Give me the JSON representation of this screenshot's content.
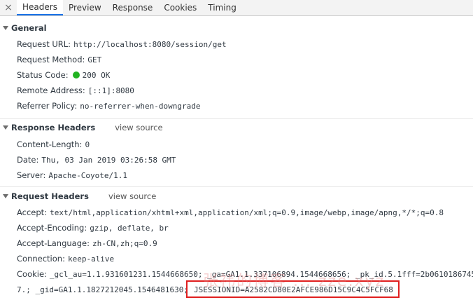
{
  "tabs": {
    "close": "×",
    "items": [
      "Headers",
      "Preview",
      "Response",
      "Cookies",
      "Timing"
    ],
    "active": "Headers"
  },
  "general": {
    "title": "General",
    "rows": [
      {
        "key": "Request URL:",
        "value": "http://localhost:8080/session/get"
      },
      {
        "key": "Request Method:",
        "value": "GET"
      },
      {
        "key": "Status Code:",
        "value": "200 OK"
      },
      {
        "key": "Remote Address:",
        "value": "[::1]:8080"
      },
      {
        "key": "Referrer Policy:",
        "value": "no-referrer-when-downgrade"
      }
    ]
  },
  "response_headers": {
    "title": "Response Headers",
    "view_source": "view source",
    "rows": [
      {
        "key": "Content-Length:",
        "value": "0"
      },
      {
        "key": "Date:",
        "value": "Thu, 03 Jan 2019 03:26:58 GMT"
      },
      {
        "key": "Server:",
        "value": "Apache-Coyote/1.1"
      }
    ]
  },
  "request_headers": {
    "title": "Request Headers",
    "view_source": "view source",
    "rows": [
      {
        "key": "Accept:",
        "value": "text/html,application/xhtml+xml,application/xml;q=0.9,image/webp,image/apng,*/*;q=0.8"
      },
      {
        "key": "Accept-Encoding:",
        "value": "gzip, deflate, br"
      },
      {
        "key": "Accept-Language:",
        "value": "zh-CN,zh;q=0.9"
      },
      {
        "key": "Connection:",
        "value": "keep-alive"
      }
    ],
    "cookie_key": "Cookie:",
    "cookie_line1": "_gcl_au=1.1.931601231.1544668650; _ga=GA1.1.337106894.1544668656; _pk_id.5.1fff=2b0610186745",
    "cookie_line2": "7.; _gid=GA1.1.1827212045.1546481630;",
    "cookie_session": "JSESSIONID=A2582CD80E2AFCE986D15C9C4C5FCF68"
  },
  "watermark": "张祎的博客 ... zze.xyz",
  "colors": {
    "status_ok": "#21b321",
    "highlight": "#e01f1f",
    "active_tab": "#1a73e8"
  }
}
